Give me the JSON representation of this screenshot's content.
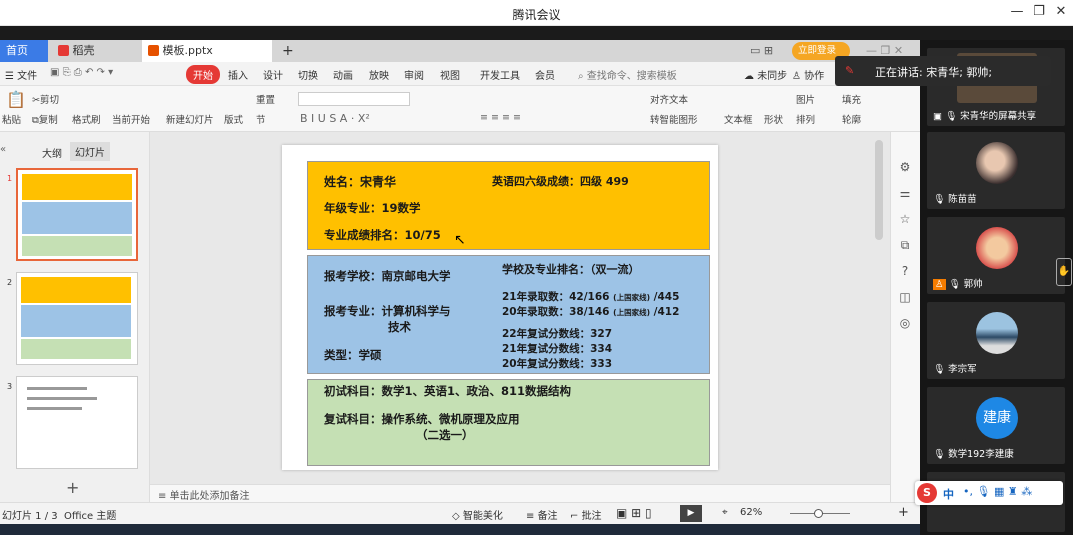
{
  "window": {
    "title": "腾讯会议",
    "minimize": "—",
    "restore": "❐",
    "close": "✕"
  },
  "tabs": {
    "home": "首页",
    "wps": "稻壳",
    "doc": "模板.pptx",
    "add": "+",
    "login": "立即登录"
  },
  "menu": {
    "file": "文件",
    "start": "开始",
    "insert": "插入",
    "design": "设计",
    "switch": "切换",
    "anim": "动画",
    "show": "放映",
    "review": "审阅",
    "view": "视图",
    "dev": "开发工具",
    "member": "会员",
    "search": "查找命令、搜索模板",
    "sync": "未同步",
    "collab": "协作"
  },
  "ribbon": {
    "paste": "粘贴",
    "cut": "剪切",
    "copy": "复制",
    "format": "格式刷",
    "fromcur": "当前开始",
    "newslide": "新建幻灯片",
    "layout": "版式",
    "section": "节",
    "reset": "重置",
    "textbox": "文本框",
    "shape": "形状",
    "picture": "图片",
    "arrange": "排列",
    "fill": "填充",
    "outline": "轮廓",
    "align": "对齐文本",
    "smart": "转智能图形"
  },
  "panel": {
    "outline": "大纲",
    "slides": "幻灯片",
    "add": "+",
    "n1": "1",
    "n2": "2",
    "n3": "3"
  },
  "slide": {
    "name": "姓名：宋青华",
    "grade": "年级专业：19数学",
    "rank": "专业成绩排名：10/75",
    "cet": "英语四六级成绩：四级 499",
    "school": "报考学校：南京邮电大学",
    "major1": "报考专业：计算机科学与",
    "major2": "技术",
    "type": "类型：学硕",
    "srank": "学校及专业排名：（双一流）",
    "r21a": "21年录取数：42/166",
    "r21b": "(上国家线)",
    "r21c": "/445",
    "r20a": "20年录取数：38/146",
    "r20b": "(上国家线)",
    "r20c": "/412",
    "l22": "22年复试分数线：327",
    "l21": "21年复试分数线：334",
    "l20": "20年复试分数线：333",
    "init": "初试科目：数学1、英语1、政治、811数据结构",
    "retest": "复试科目：操作系统、微机原理及应用",
    "choice": "（二选一）"
  },
  "notes": "单击此处添加备注",
  "status": {
    "page": "幻灯片 1 / 3",
    "theme": "Office 主题",
    "beautify": "智能美化",
    "notes": "备注",
    "comment": "批注",
    "zoom": "62%"
  },
  "meeting": {
    "speaking": "正在讲话: 宋青华; 郭帅;",
    "share": "宋青华的屏幕共享",
    "p1": "陈苗苗",
    "p2": "郭帅",
    "p3": "李宗军",
    "p4": "数学192李建康",
    "p4avatar": "建康"
  },
  "ime": {
    "s": "S",
    "zh": "中"
  },
  "colors": {
    "orange": "#FFC000",
    "blue": "#9DC3E6",
    "green": "#C5E0B4",
    "accent": "#E64A19"
  }
}
